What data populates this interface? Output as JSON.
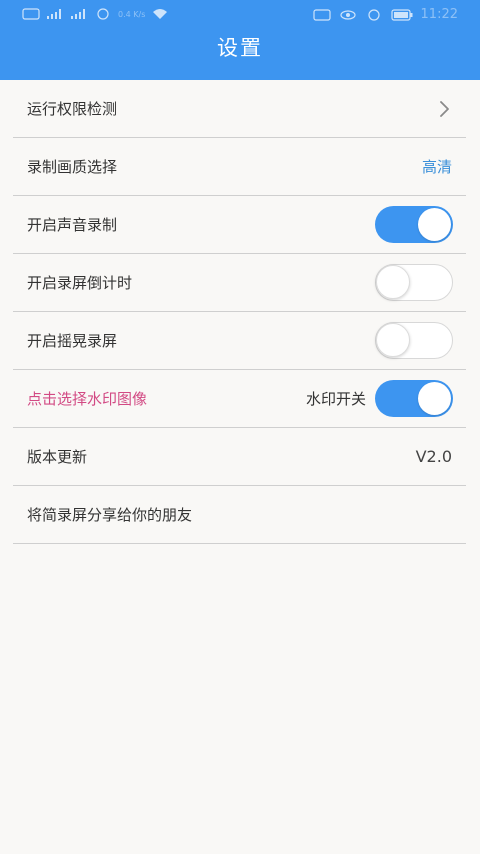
{
  "status_bar": {
    "left_icons": [
      "sim-icon",
      "signal-icon",
      "signal-icon",
      "hd-icon",
      "data-speed-icon",
      "wifi-icon"
    ],
    "data_speed": "0.4 K/s",
    "clock": "11:22"
  },
  "header": {
    "title": "设置"
  },
  "settings": {
    "permission_check": {
      "label": "运行权限检测",
      "icon": "chevron-right-icon"
    },
    "quality": {
      "label": "录制画质选择",
      "value": "高清"
    },
    "audio_record": {
      "label": "开启声音录制",
      "on": true
    },
    "countdown": {
      "label": "开启录屏倒计时",
      "on": false
    },
    "shake_record": {
      "label": "开启摇晃录屏",
      "on": false
    },
    "watermark": {
      "label": "点击选择水印图像",
      "switch_label": "水印开关",
      "on": true
    },
    "version": {
      "label": "版本更新",
      "value": "V2.0"
    },
    "share": {
      "label": "将简录屏分享给你的朋友"
    }
  },
  "colors": {
    "header": "#3d95f0",
    "accent_blue": "#3a8fd9",
    "watermark_pink": "#d24a84",
    "background": "#f9f8f6"
  }
}
